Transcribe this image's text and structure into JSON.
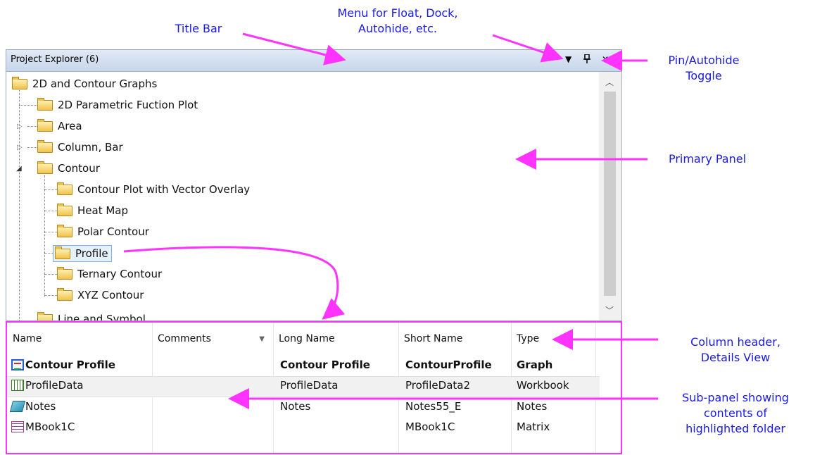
{
  "annotations": {
    "title_bar": "Title Bar",
    "menu_line1": "Menu for Float, Dock,",
    "menu_line2": "Autohide, etc.",
    "pin_line1": "Pin/Autohide",
    "pin_line2": "Toggle",
    "primary_panel": "Primary Panel",
    "column_header_line1": "Column header,",
    "column_header_line2": "Details View",
    "subpanel_line1": "Sub-panel showing",
    "subpanel_line2": "contents of",
    "subpanel_line3": "highlighted folder"
  },
  "colors": {
    "annotation_text": "#1a1ae6",
    "annotation_arrow": "#ff33ff",
    "selection": "#e5f1fb"
  },
  "window": {
    "title": "Project Explorer (6)",
    "menu_icon": "dropdown-triangle-icon",
    "pin_icon": "pin-icon",
    "close_icon": "close-icon"
  },
  "tree": {
    "root": "2D and Contour Graphs",
    "items": [
      "2D Parametric Fuction Plot",
      "Area",
      "Column, Bar",
      "Contour",
      "Contour Plot with Vector Overlay",
      "Heat Map",
      "Polar Contour",
      "Profile",
      "Ternary Contour",
      "XYZ Contour",
      "Line and Symbol"
    ],
    "selected": "Profile"
  },
  "details": {
    "columns": [
      "Name",
      "Comments",
      "Long Name",
      "Short Name",
      "Type"
    ],
    "rows": [
      {
        "icon": "graph-icon",
        "name": "Contour Profile",
        "comments": "",
        "long_name": "Contour Profile",
        "short_name": "ContourProfile",
        "type": "Graph"
      },
      {
        "icon": "workbook-icon",
        "name": "ProfileData",
        "comments": "",
        "long_name": "ProfileData",
        "short_name": "ProfileData2",
        "type": "Workbook"
      },
      {
        "icon": "notes-icon",
        "name": "Notes",
        "comments": "",
        "long_name": "Notes",
        "short_name": "Notes55_E",
        "type": "Notes"
      },
      {
        "icon": "matrix-icon",
        "name": "MBook1C",
        "comments": "",
        "long_name": "",
        "short_name": "MBook1C",
        "type": "Matrix"
      }
    ]
  }
}
